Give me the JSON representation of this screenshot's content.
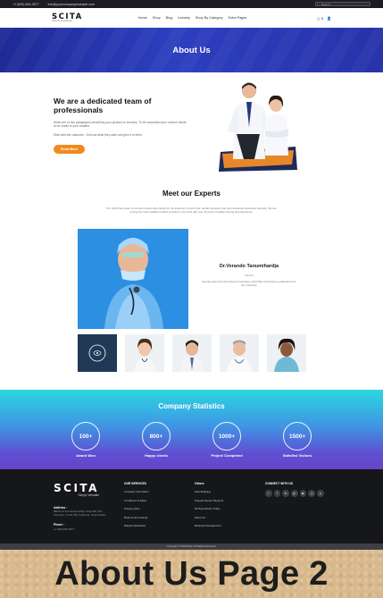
{
  "topbar": {
    "phone": "+1 (609) 891-3577",
    "email": "info@yourcompanyexample.com",
    "search_placeholder": "Search"
  },
  "nav": {
    "logo": "SCITA",
    "logo_sub": "Simply Versatile",
    "links": [
      "Home",
      "Shop",
      "Blog",
      "Industry",
      "Shop By Category",
      "Extra Pages"
    ],
    "cart_count": "0"
  },
  "hero": {
    "title": "About Us"
  },
  "team": {
    "heading": "We are a dedicated team of professionals",
    "p1": "Write one or two paragraphs describing your product or services. To be successful your content needs to be useful to your readers.",
    "p2": "Start with the customer – find out what they want and give it to them.",
    "button": "Read More"
  },
  "experts": {
    "title": "Meet our Experts",
    "description": "Our Clinic has grown to provide a world class facility for the treatment of tooth loss, dental cosmetics and bore advanced restorative dentistry. We are among the most qualified implant providers in the AUS with over 30 years of quality training and experience.",
    "featured": {
      "name": "Dr.Verando Tanumihardja",
      "role": "Dentist",
      "bio": "Verando was born and raised in Indonesia, North Bay Indonesia he graduated from the University."
    }
  },
  "stats": {
    "title": "Company Statistics",
    "items": [
      {
        "value": "100+",
        "label": "Award Won"
      },
      {
        "value": "800+",
        "label": "Happy clients"
      },
      {
        "value": "1000+",
        "label": "Project Completed"
      },
      {
        "value": "1500+",
        "label": "Satisfied Visitors"
      }
    ]
  },
  "footer": {
    "logo": "SCITA",
    "logo_sub": "Simply Versatile",
    "address_label": "Address :",
    "address": "888 Proot Ave Street Hollow, Suite 540, San Francisco, CA 94 758, California, United States",
    "phone_label": "Phone :",
    "phone": "+1 (609) 891-3577",
    "col1": {
      "heading": "OUR SERVICES",
      "items": [
        "Company Information",
        "Conditions of Sales",
        "Privacy policy",
        "Returns and refunds",
        "Dispute Resolution"
      ]
    },
    "col2": {
      "heading": "Others",
      "items": [
        "Fast Shipping",
        "Prepaid Secure Payment",
        "30 Days Return Policy",
        "About Us",
        "Business Development"
      ]
    },
    "col3": {
      "heading": "CONNECT WITH US",
      "socials": [
        "f",
        "t",
        "in",
        "g+",
        "▶",
        "◎",
        "p"
      ]
    }
  },
  "copyright": "Copyright © 2019 Scita. All Rights Reserved.",
  "banner": "About Us Page 2"
}
